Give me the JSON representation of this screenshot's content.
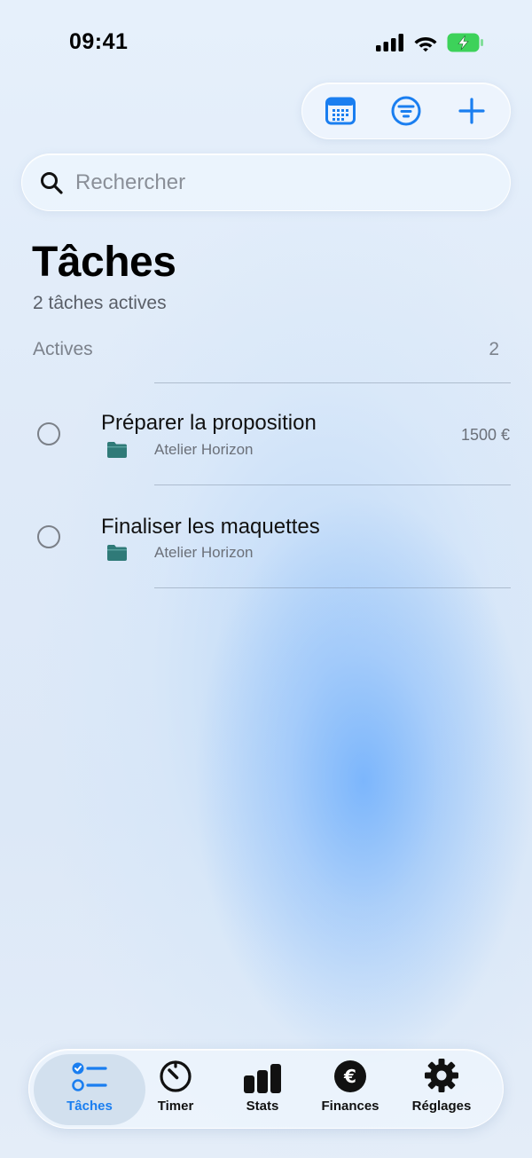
{
  "status_bar": {
    "time": "09:41"
  },
  "toolbar": {
    "buttons": [
      {
        "icon": "calendar-icon"
      },
      {
        "icon": "filter-icon"
      },
      {
        "icon": "plus-icon"
      }
    ]
  },
  "search": {
    "placeholder": "Rechercher"
  },
  "page": {
    "title": "Tâches",
    "subtitle": "2 tâches actives"
  },
  "section": {
    "label": "Actives",
    "count": "2"
  },
  "tasks": [
    {
      "title": "Préparer la proposition",
      "client": "Atelier Horizon",
      "amount": "1500 €"
    },
    {
      "title": "Finaliser les maquettes",
      "client": "Atelier Horizon",
      "amount": ""
    }
  ],
  "tabbar": {
    "tabs": [
      {
        "label": "Tâches",
        "icon": "tasks-list-icon",
        "active": true
      },
      {
        "label": "Timer",
        "icon": "timer-icon",
        "active": false
      },
      {
        "label": "Stats",
        "icon": "bar-chart-icon",
        "active": false
      },
      {
        "label": "Finances",
        "icon": "euro-icon",
        "active": false
      },
      {
        "label": "Réglages",
        "icon": "gear-icon",
        "active": false
      }
    ]
  },
  "colors": {
    "accent": "#1a7ef0",
    "folder": "#2f7a78",
    "text_secondary": "#6b7079"
  }
}
